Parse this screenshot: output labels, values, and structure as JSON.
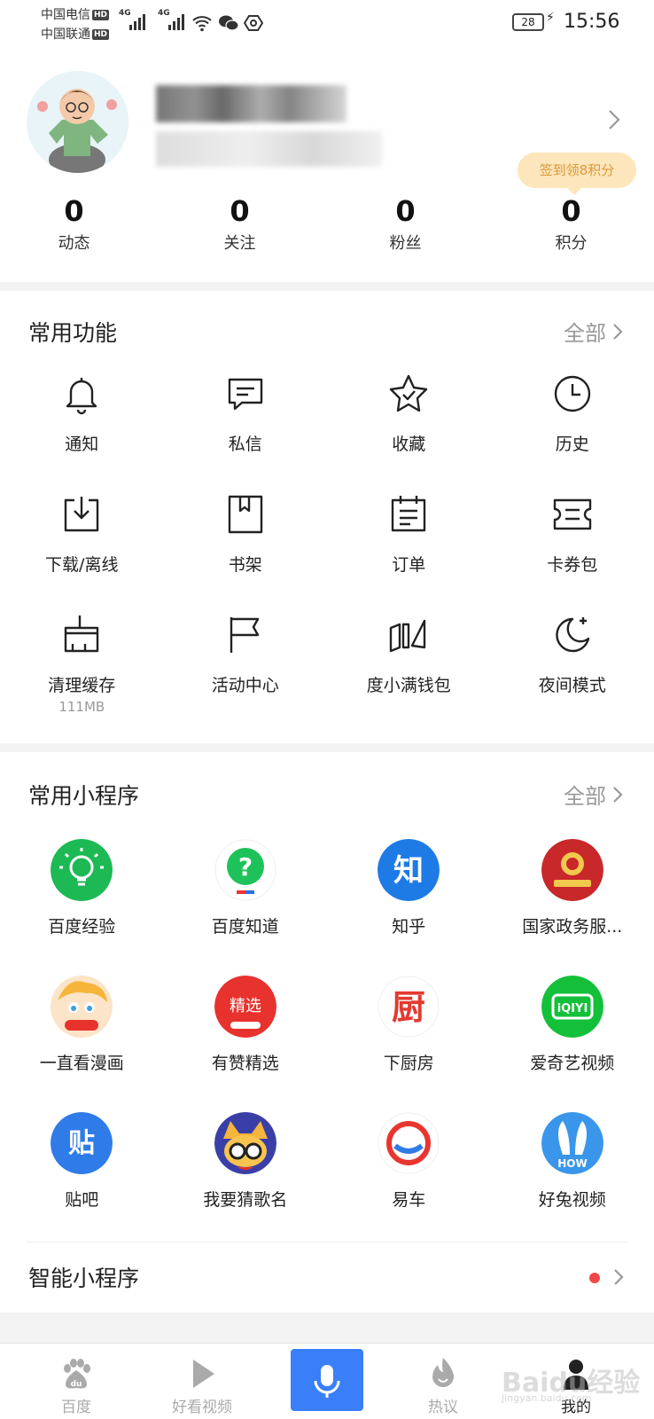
{
  "status_bar": {
    "carrier1": "中国电信",
    "carrier2": "中国联通",
    "hd": "HD",
    "net1": "4G",
    "net2": "4G",
    "battery": "28",
    "time": "15:56"
  },
  "profile": {
    "signin_label": "签到领8积分",
    "stats": [
      {
        "value": "0",
        "label": "动态"
      },
      {
        "value": "0",
        "label": "关注"
      },
      {
        "value": "0",
        "label": "粉丝"
      },
      {
        "value": "0",
        "label": "积分"
      }
    ]
  },
  "common_functions": {
    "title": "常用功能",
    "all": "全部",
    "items": [
      {
        "label": "通知",
        "icon": "bell-icon"
      },
      {
        "label": "私信",
        "icon": "message-icon"
      },
      {
        "label": "收藏",
        "icon": "star-icon"
      },
      {
        "label": "历史",
        "icon": "clock-icon"
      },
      {
        "label": "下载/离线",
        "icon": "download-icon"
      },
      {
        "label": "书架",
        "icon": "bookshelf-icon"
      },
      {
        "label": "订单",
        "icon": "order-icon"
      },
      {
        "label": "卡券包",
        "icon": "coupon-icon"
      },
      {
        "label": "清理缓存",
        "icon": "broom-icon",
        "sub": "111MB"
      },
      {
        "label": "活动中心",
        "icon": "flag-icon"
      },
      {
        "label": "度小满钱包",
        "icon": "wallet-icon"
      },
      {
        "label": "夜间模式",
        "icon": "moon-icon"
      }
    ]
  },
  "mini_programs": {
    "title": "常用小程序",
    "all": "全部",
    "items": [
      {
        "label": "百度经验",
        "icon": "baidu-jingyan-icon",
        "color": "#1db954"
      },
      {
        "label": "百度知道",
        "icon": "baidu-zhidao-icon",
        "color": "#1ec25a"
      },
      {
        "label": "知乎",
        "icon": "zhihu-icon",
        "color": "#1e7be6",
        "glyph": "知"
      },
      {
        "label": "国家政务服...",
        "icon": "gov-service-icon",
        "color": "#c8282a"
      },
      {
        "label": "一直看漫画",
        "icon": "manga-icon",
        "color": "#f7c44e"
      },
      {
        "label": "有赞精选",
        "icon": "youzan-icon",
        "color": "#e8322d",
        "glyph": "精选"
      },
      {
        "label": "下厨房",
        "icon": "xiachufang-icon",
        "color": "#e23a2f",
        "glyph": "厨"
      },
      {
        "label": "爱奇艺视频",
        "icon": "iqiyi-icon",
        "color": "#14c03a",
        "glyph": "iQIYI"
      },
      {
        "label": "贴吧",
        "icon": "tieba-icon",
        "color": "#2f7be8",
        "glyph": "贴"
      },
      {
        "label": "我要猜歌名",
        "icon": "guess-song-icon",
        "color": "#3a3fa8"
      },
      {
        "label": "易车",
        "icon": "yiche-icon",
        "color": "#e8362f"
      },
      {
        "label": "好兔视频",
        "icon": "haotu-icon",
        "color": "#3a96ea",
        "glyph": "HOW"
      }
    ]
  },
  "smart_programs": {
    "title": "智能小程序"
  },
  "tabbar": [
    {
      "label": "百度",
      "icon": "baidu-paw-icon"
    },
    {
      "label": "好看视频",
      "icon": "play-icon"
    },
    {
      "label": "",
      "icon": "mic-icon"
    },
    {
      "label": "热议",
      "icon": "flame-icon"
    },
    {
      "label": "我的",
      "icon": "person-icon"
    }
  ],
  "watermark": {
    "text": "Baidu经验",
    "sub": "jingyan.baidu.com"
  }
}
